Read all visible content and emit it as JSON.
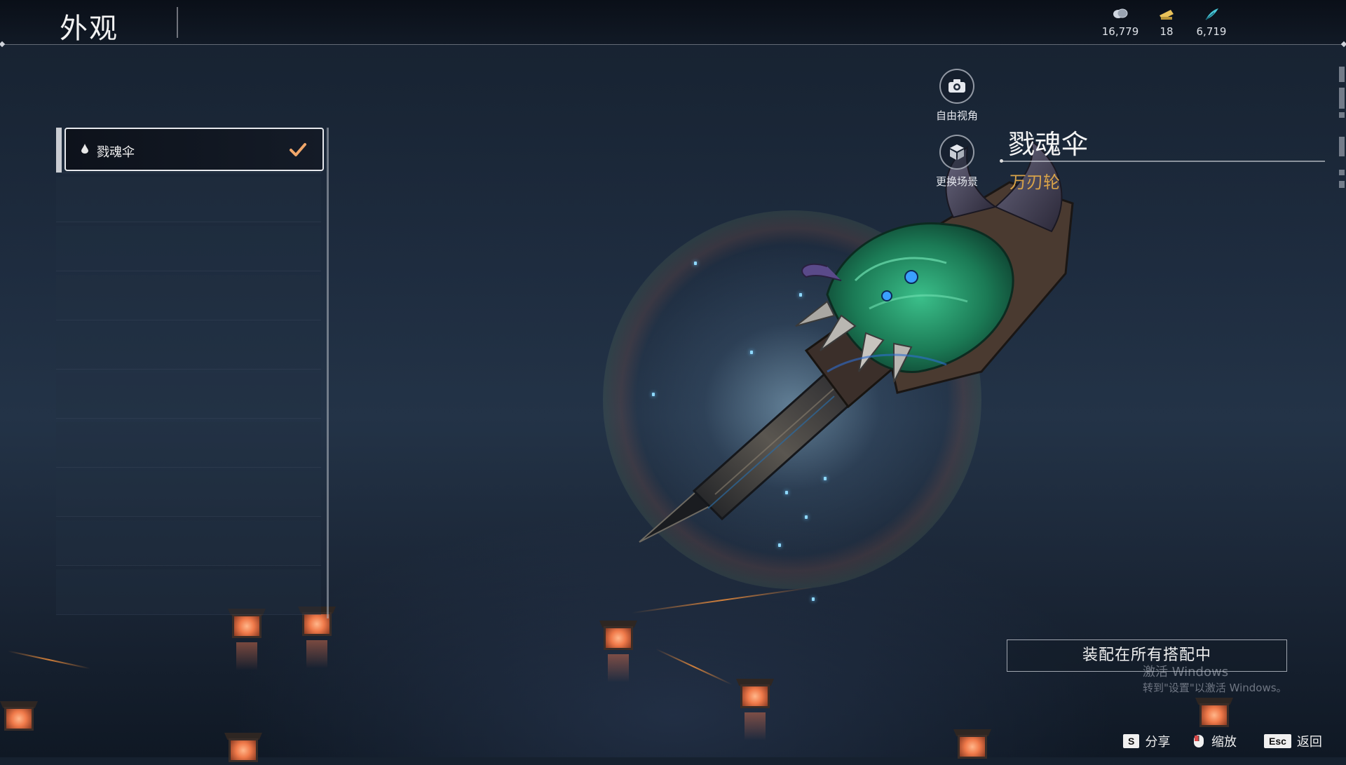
{
  "header": {
    "title": "外观",
    "currencies": [
      {
        "icon": "coin-icon",
        "value": "16,779",
        "color": "#cfd6e0"
      },
      {
        "icon": "ticket-icon",
        "value": "18",
        "color": "#e9c25b"
      },
      {
        "icon": "feather-icon",
        "value": "6,719",
        "color": "#49c6d6"
      }
    ]
  },
  "skin_list": {
    "items": [
      {
        "label": "戮魂伞",
        "selected": true,
        "equipped": true
      }
    ]
  },
  "actions": {
    "free_view": "自由视角",
    "change_scene": "更换场景"
  },
  "item": {
    "name": "戮魂伞",
    "type": "万刃轮"
  },
  "equip_button": "装配在所有搭配中",
  "watermark": {
    "line1": "激活 Windows",
    "line2": "转到\"设置\"以激活 Windows。"
  },
  "hints": [
    {
      "key": "S",
      "label": "分享"
    },
    {
      "key": "zoom-icon",
      "label": "缩放"
    },
    {
      "key": "Esc",
      "label": "返回"
    }
  ],
  "colors": {
    "accent_gold": "#d9a349",
    "check": "#f0a66a"
  }
}
